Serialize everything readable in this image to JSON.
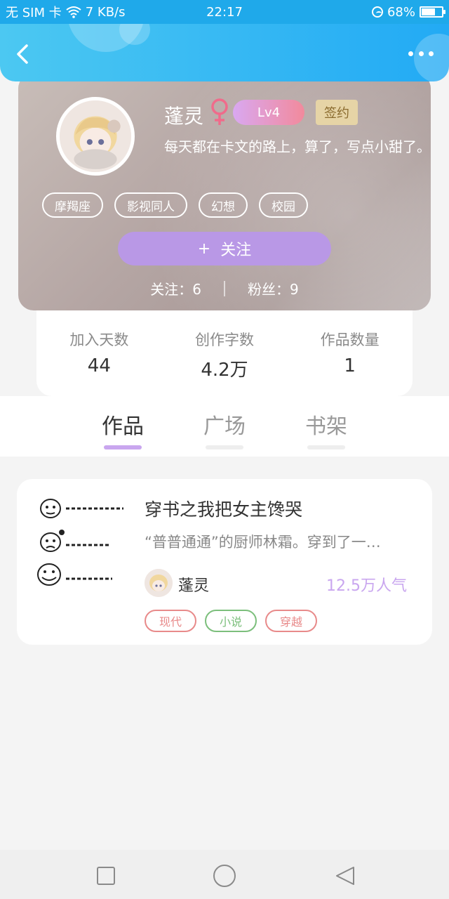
{
  "status_bar": {
    "carrier": "无 SIM 卡",
    "network_speed": "7 KB/s",
    "time": "22:17",
    "battery_percent": "68%",
    "battery_level": 0.68
  },
  "header": {
    "back_icon": "chevron-left-icon",
    "more_icon": "more-dots-icon",
    "color": "#22aaf4"
  },
  "profile": {
    "username": "蓬灵",
    "gender": "♀",
    "level": "Lv4",
    "sign_badge": "签约",
    "bio": "每天都在卡文的路上，算了，写点小甜了。",
    "tags": [
      "摩羯座",
      "影视同人",
      "幻想",
      "校园"
    ],
    "follow_plus": "+",
    "follow_label": "关注",
    "following_label": "关注：6",
    "fans_label": "粉丝：9"
  },
  "stats": [
    {
      "label": "加入天数",
      "value": "44"
    },
    {
      "label": "创作字数",
      "value": "4.2万"
    },
    {
      "label": "作品数量",
      "value": "1"
    }
  ],
  "tabs": [
    {
      "label": "作品",
      "active": true
    },
    {
      "label": "广场",
      "active": false
    },
    {
      "label": "书架",
      "active": false
    }
  ],
  "work": {
    "title": "穿书之我把女主馋哭",
    "description": "“普普通通”的厨师林霜。穿到了一…",
    "author": "蓬灵",
    "popularity": "12.5万人气",
    "genres": [
      {
        "label": "现代",
        "color": "#e88a8a"
      },
      {
        "label": "小说",
        "color": "#7cbf7c"
      },
      {
        "label": "穿越",
        "color": "#e88a8a"
      }
    ]
  },
  "nav": {
    "recent_icon": "square-icon",
    "home_icon": "circle-icon",
    "back_icon": "triangle-back-icon"
  }
}
